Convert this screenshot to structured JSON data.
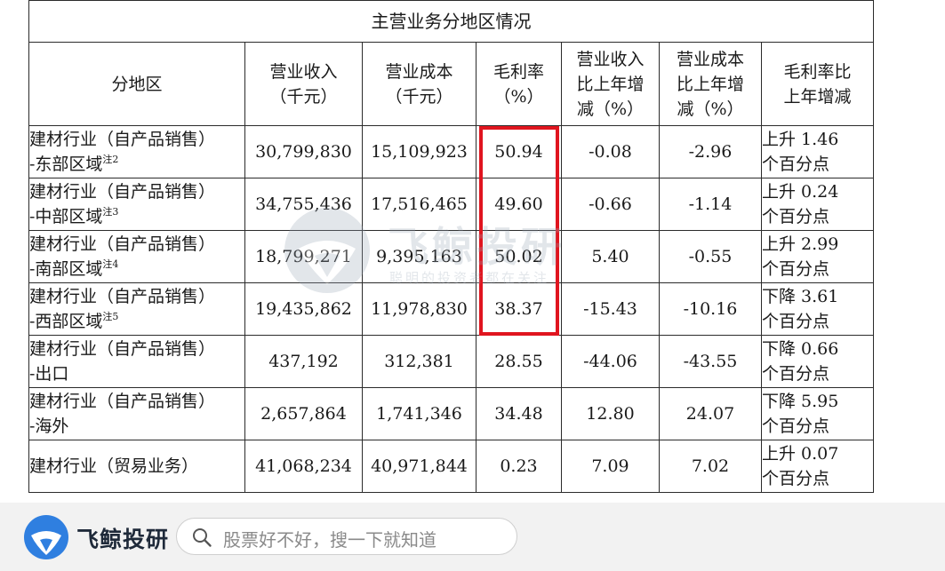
{
  "table": {
    "title": "主营业务分地区情况",
    "headers": {
      "region": "分地区",
      "revenue": [
        "营业收入",
        "（千元）"
      ],
      "cost": [
        "营业成本",
        "（千元）"
      ],
      "margin": [
        "毛利率",
        "（%）"
      ],
      "rev_change": [
        "营业收入",
        "比上年增",
        "减（%）"
      ],
      "cost_change": [
        "营业成本",
        "比上年增",
        "减（%）"
      ],
      "margin_change": [
        "毛利率比",
        "上年增减"
      ]
    },
    "rows": [
      {
        "name1": "建材行业（自产品销售）",
        "name2": "-东部区域",
        "note": "注2",
        "revenue": "30,799,830",
        "cost": "15,109,923",
        "margin": "50.94",
        "rev_change": "-0.08",
        "cost_change": "-2.96",
        "margin_change1": "上升 1.46",
        "margin_change2": "个百分点"
      },
      {
        "name1": "建材行业（自产品销售）",
        "name2": "-中部区域",
        "note": "注3",
        "revenue": "34,755,436",
        "cost": "17,516,465",
        "margin": "49.60",
        "rev_change": "-0.66",
        "cost_change": "-1.14",
        "margin_change1": "上升 0.24",
        "margin_change2": "个百分点"
      },
      {
        "name1": "建材行业（自产品销售）",
        "name2": "-南部区域",
        "note": "注4",
        "revenue": "18,799,271",
        "cost": "9,395,163",
        "margin": "50.02",
        "rev_change": "5.40",
        "cost_change": "-0.55",
        "margin_change1": "上升 2.99",
        "margin_change2": "个百分点"
      },
      {
        "name1": "建材行业（自产品销售）",
        "name2": "-西部区域",
        "note": "注5",
        "revenue": "19,435,862",
        "cost": "11,978,830",
        "margin": "38.37",
        "rev_change": "-15.43",
        "cost_change": "-10.16",
        "margin_change1": "下降 3.61",
        "margin_change2": "个百分点"
      },
      {
        "name1": "建材行业（自产品销售）",
        "name2": "-出口",
        "note": "",
        "revenue": "437,192",
        "cost": "312,381",
        "margin": "28.55",
        "rev_change": "-44.06",
        "cost_change": "-43.55",
        "margin_change1": "下降 0.66",
        "margin_change2": "个百分点"
      },
      {
        "name1": "建材行业（自产品销售）",
        "name2": "-海外",
        "note": "",
        "revenue": "2,657,864",
        "cost": "1,741,346",
        "margin": "34.48",
        "rev_change": "12.80",
        "cost_change": "24.07",
        "margin_change1": "下降 5.95",
        "margin_change2": "个百分点"
      },
      {
        "name1": "建材行业（贸易业务）",
        "name2": "",
        "note": "",
        "revenue": "41,068,234",
        "cost": "40,971,844",
        "margin": "0.23",
        "rev_change": "7.09",
        "cost_change": "7.02",
        "margin_change1": "上升 0.07",
        "margin_change2": "个百分点"
      }
    ]
  },
  "watermark": {
    "text": "飞鲸投研",
    "sub": "聪明的投资者都在关注"
  },
  "bottom_bar": {
    "brand": "飞鲸投研",
    "search_placeholder": "股票好不好，搜一下就知道",
    "icons": {
      "logo": "whale-logo-icon",
      "search": "search-icon"
    }
  },
  "colors": {
    "highlight": "#e0151f",
    "brand_blue": "#2f7fe0"
  }
}
